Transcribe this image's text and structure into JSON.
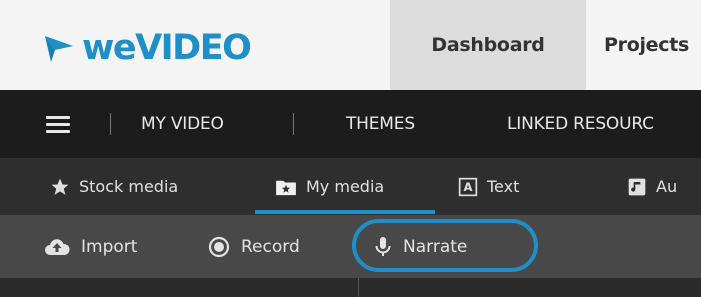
{
  "app": {
    "logo_text": "weVIDEO",
    "brand_color": "#1e8fc7"
  },
  "top_nav": {
    "tabs": [
      {
        "label": "Dashboard",
        "active": true
      },
      {
        "label": "Projects",
        "active": false
      }
    ]
  },
  "menu_bar": {
    "menu_icon": "hamburger-icon",
    "items": [
      "MY VIDEO",
      "THEMES",
      "LINKED RESOURC"
    ]
  },
  "media_tabs": {
    "items": [
      {
        "label": "Stock media",
        "icon": "star-icon",
        "active": false
      },
      {
        "label": "My media",
        "icon": "folder-star-icon",
        "active": true
      },
      {
        "label": "Text",
        "icon": "text-box-icon",
        "active": false
      },
      {
        "label": "Au",
        "icon": "music-icon",
        "active": false
      }
    ]
  },
  "actions": {
    "items": [
      {
        "label": "Import",
        "icon": "cloud-upload-icon"
      },
      {
        "label": "Record",
        "icon": "record-icon"
      },
      {
        "label": "Narrate",
        "icon": "microphone-icon",
        "highlighted": true
      }
    ]
  }
}
